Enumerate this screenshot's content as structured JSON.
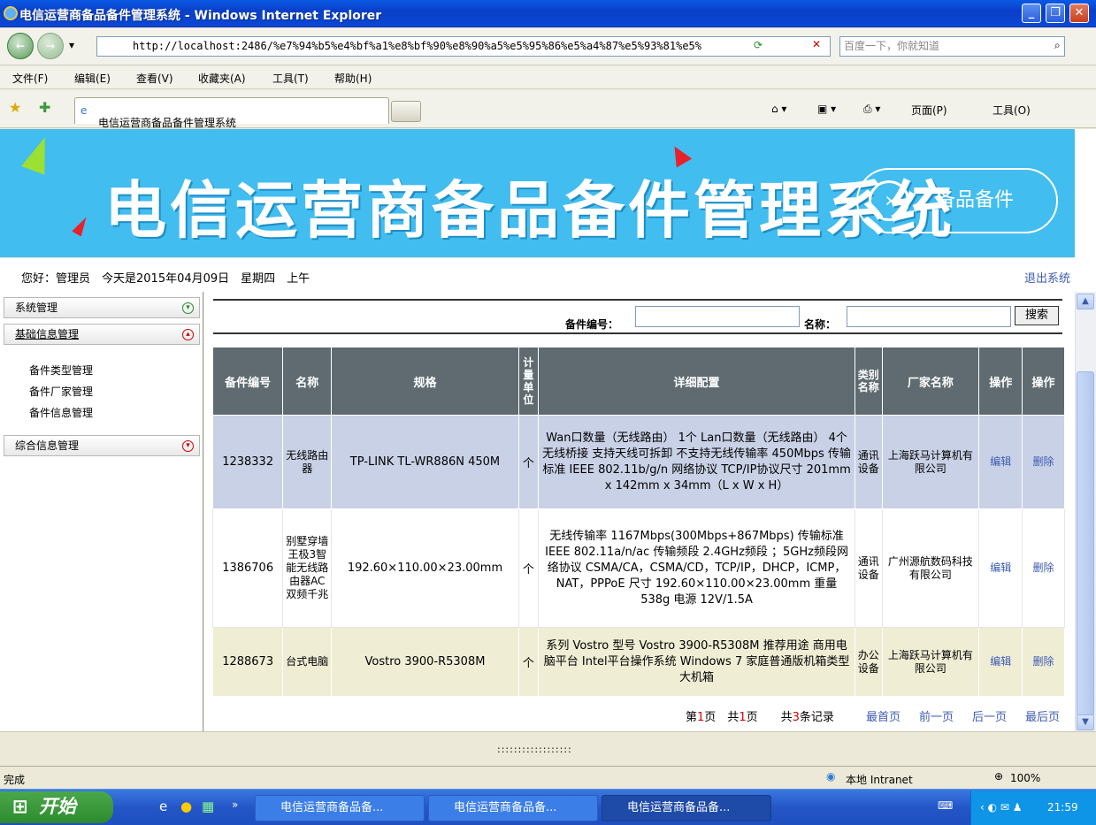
{
  "window": {
    "title": "电信运营商备品备件管理系统 - Windows Internet Explorer"
  },
  "browser": {
    "address": "http://localhost:2486/%e7%94%b5%e4%bf%a1%e8%bf%90%e8%90%a5%e5%95%86%e5%a4%87%e5%93%81%e5%",
    "search_placeholder": "百度一下，你就知道",
    "menu": [
      "文件(F)",
      "编辑(E)",
      "查看(V)",
      "收藏夹(A)",
      "工具(T)",
      "帮助(H)"
    ],
    "tab_title": "电信运营商备品备件管理系统",
    "page_menu": "页面(P)",
    "tools_menu": "工具(O)"
  },
  "banner": {
    "title": "电信运营商备品备件管理系统",
    "badge": "备品备件"
  },
  "info": {
    "greeting": "您好：管理员　今天是2015年04月09日　星期四　上午",
    "logout": "退出系统"
  },
  "sidebar": {
    "system": "系统管理",
    "basic": "基础信息管理",
    "items": [
      "备件类型管理",
      "备件厂家管理",
      "备件信息管理"
    ],
    "comprehensive": "综合信息管理"
  },
  "search": {
    "code_label": "备件编号：",
    "name_label": "名称：",
    "button": "搜索"
  },
  "table": {
    "headers": [
      "备件编号",
      "名称",
      "规格",
      "计量单位",
      "详细配置",
      "类别名称",
      "厂家名称",
      "操作",
      "操作"
    ],
    "rows": [
      {
        "code": "1238332",
        "name": "无线路由器",
        "spec": "TP-LINK TL-WR886N 450M",
        "unit": "个",
        "detail": "Wan口数量（无线路由） 1个 Lan口数量（无线路由） 4个无线桥接 支持天线可拆卸 不支持无线传输率 450Mbps 传输标准 IEEE 802.11b/g/n 网络协议 TCP/IP协议尺寸 201mm x 142mm x 34mm（L x W x H）",
        "category": "通讯设备",
        "vendor": "上海跃马计算机有限公司",
        "edit": "编辑",
        "delete": "删除"
      },
      {
        "code": "1386706",
        "name": "别墅穿墙王极3智能无线路由器AC双频千兆",
        "spec": "192.60×110.00×23.00mm",
        "unit": "个",
        "detail": "无线传输率 1167Mbps(300Mbps+867Mbps) 传输标准 IEEE 802.11a/n/ac 传输频段 2.4GHz频段 ；5GHz频段网络协议 CSMA/CA，CSMA/CD，TCP/IP，DHCP，ICMP，NAT，PPPoE 尺寸 192.60×110.00×23.00mm 重量 538g 电源 12V/1.5A",
        "category": "通讯设备",
        "vendor": "广州源航数码科技有限公司",
        "edit": "编辑",
        "delete": "删除"
      },
      {
        "code": "1288673",
        "name": "台式电脑",
        "spec": "Vostro 3900-R5308M",
        "unit": "个",
        "detail": "系列 Vostro 型号 Vostro 3900-R5308M 推荐用途 商用电脑平台 Intel平台操作系统 Windows 7 家庭普通版机箱类型 大机箱",
        "category": "办公设备",
        "vendor": "上海跃马计算机有限公司",
        "edit": "编辑",
        "delete": "删除"
      }
    ]
  },
  "pager": {
    "p1": "第",
    "cur": "1",
    "p2": "页　共",
    "total": "1",
    "p3": "页　　共",
    "count": "3",
    "p4": "条记录",
    "first": "最首页",
    "prev": "前一页",
    "next": "后一页",
    "last": "最后页"
  },
  "frame_splitter": "::::::::::::::::::",
  "status": {
    "text": "完成",
    "zone": "本地 Intranet",
    "zoom": "100%"
  },
  "taskbar": {
    "start": "开始",
    "buttons": [
      "电信运营商备品备...",
      "电信运营商备品备...",
      "电信运营商备品备..."
    ],
    "clock": "21:59"
  }
}
